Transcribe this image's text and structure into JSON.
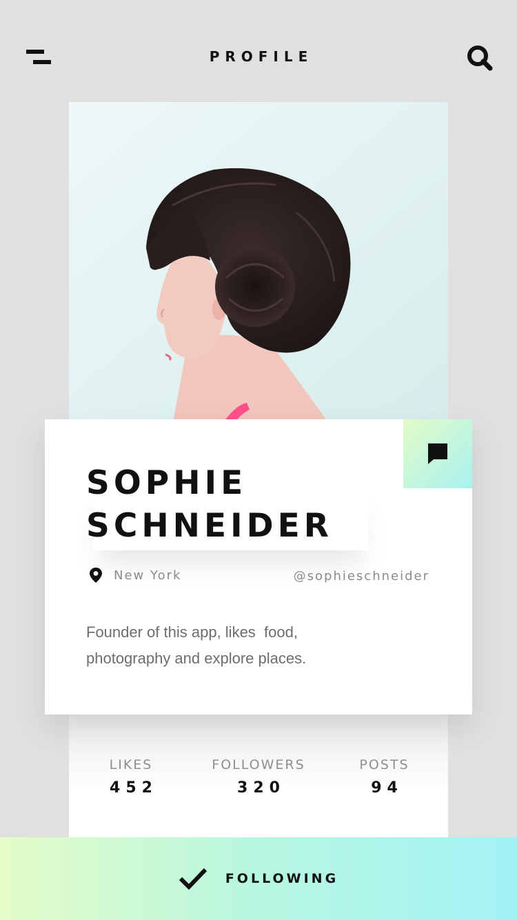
{
  "header": {
    "title": "PROFILE",
    "menu_icon": "menu-icon",
    "search_icon": "search-icon"
  },
  "profile": {
    "first_name": "SOPHIE",
    "last_name": "SCHNEIDER",
    "location": "New York",
    "handle": "@sophieschneider",
    "bio_line1": "Founder of this app, likes  food,",
    "bio_line2": "photography and explore places.",
    "chat_icon": "chat-bubble-icon",
    "location_icon": "location-pin-icon"
  },
  "stats": [
    {
      "label": "LIKES",
      "value": "452"
    },
    {
      "label": "FOLLOWERS",
      "value": "320"
    },
    {
      "label": "POSTS",
      "value": "94"
    }
  ],
  "follow": {
    "label": "FOLLOWING",
    "icon": "checkmark-icon"
  },
  "colors": {
    "background": "#e0e0e0",
    "text": "#111111",
    "muted": "#8a8a8a",
    "gradient_start": "#e2fbc7",
    "gradient_end": "#a4f2f6"
  }
}
